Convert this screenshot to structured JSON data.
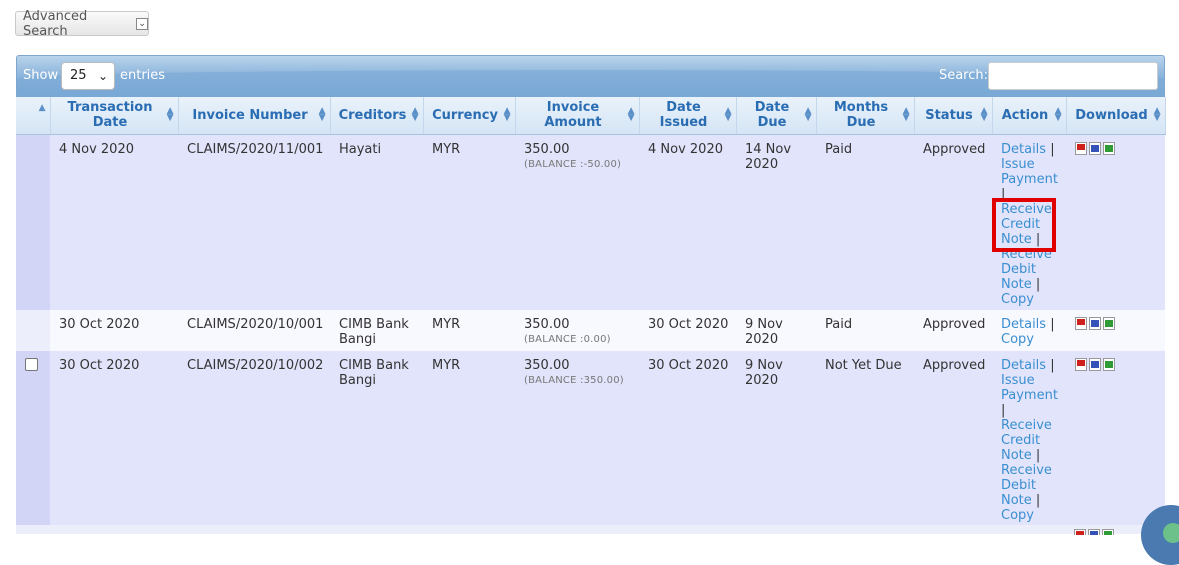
{
  "advanced_search": {
    "label": "Advanced Search",
    "caret": "⌄"
  },
  "toolbar": {
    "show_label": "Show",
    "entries_value": "25",
    "entries_label": "entries",
    "search_label": "Search:",
    "search_value": ""
  },
  "columns": [
    {
      "label": "",
      "sort": "▲"
    },
    {
      "label": "Transaction Date"
    },
    {
      "label": "Invoice Number"
    },
    {
      "label": "Creditors"
    },
    {
      "label": "Currency"
    },
    {
      "label": "Invoice Amount"
    },
    {
      "label": "Date Issued"
    },
    {
      "label": "Date Due"
    },
    {
      "label": "Months Due"
    },
    {
      "label": "Status"
    },
    {
      "label": "Action"
    },
    {
      "label": "Download"
    }
  ],
  "rows": [
    {
      "date": "4 Nov 2020",
      "invoice": "CLAIMS/2020/11/001",
      "creditor": "Hayati",
      "currency": "MYR",
      "amount": "350.00",
      "balance": "(BALANCE :-50.00)",
      "issued": "4 Nov 2020",
      "due": "14 Nov 2020",
      "months_due": "Paid",
      "status": "Approved",
      "actions": [
        "Details",
        "Issue Payment",
        "Receive Credit Note",
        "Receive Debit Note",
        "Copy"
      ]
    },
    {
      "date": "30 Oct 2020",
      "invoice": "CLAIMS/2020/10/001",
      "creditor": "CIMB Bank Bangi",
      "currency": "MYR",
      "amount": "350.00",
      "balance": "(BALANCE :0.00)",
      "issued": "30 Oct 2020",
      "due": "9 Nov 2020",
      "months_due": "Paid",
      "status": "Approved",
      "actions": [
        "Details",
        "Copy"
      ]
    },
    {
      "date": "30 Oct 2020",
      "invoice": "CLAIMS/2020/10/002",
      "creditor": "CIMB Bank Bangi",
      "currency": "MYR",
      "amount": "350.00",
      "balance": "(BALANCE :350.00)",
      "issued": "30 Oct 2020",
      "due": "9 Nov 2020",
      "months_due": "Not Yet Due",
      "status": "Approved",
      "actions": [
        "Details",
        "Issue Payment",
        "Receive Credit Note",
        "Receive Debit Note",
        "Copy"
      ]
    }
  ],
  "separator": "|",
  "colors": {
    "accent": "#2a6db3",
    "link": "#3a8fd0",
    "paid": "#2e8b2e",
    "highlight": "#e00000"
  }
}
